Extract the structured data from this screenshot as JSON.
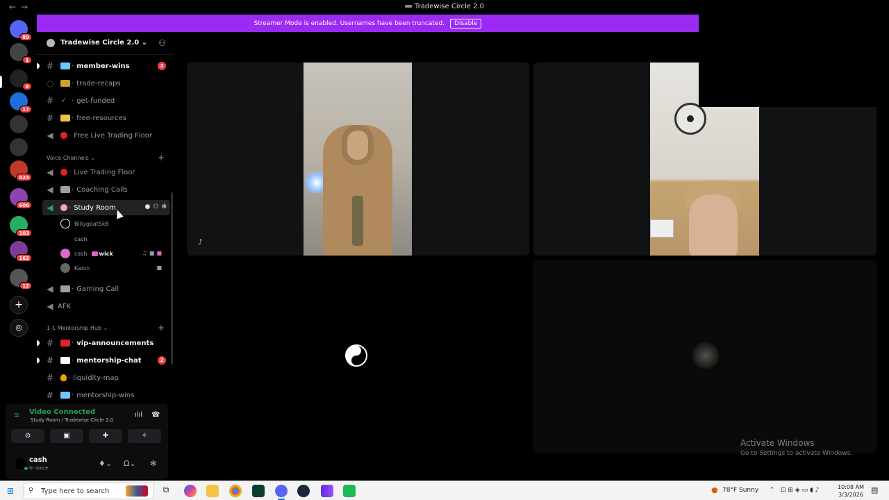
{
  "window": {
    "title": "Tradewise Circle 2.0",
    "back": "←",
    "forward": "→"
  },
  "banner": {
    "text": "Streamer Mode is enabled. Usernames have been truncated.",
    "button": "Disable"
  },
  "servers": [
    {
      "badge": "89",
      "color": "#5865f2"
    },
    {
      "badge": "1",
      "color": "#444"
    },
    {
      "badge": "8",
      "color": "#222"
    },
    {
      "badge": "17",
      "color": "#1e6fd9"
    },
    {
      "badge": "",
      "color": "#333"
    },
    {
      "badge": "",
      "color": "#333"
    },
    {
      "badge": "523",
      "color": "#c0392b"
    },
    {
      "badge": "606",
      "color": "#8e44ad"
    },
    {
      "badge": "103",
      "color": "#27ae60"
    },
    {
      "badge": "162",
      "color": "#7d3c98"
    },
    {
      "badge": "12",
      "color": "#555"
    }
  ],
  "guild": {
    "name": "Tradewise Circle 2.0 ⌄",
    "icon": "guild-gear-icon"
  },
  "channels": {
    "member_wins": {
      "label": "member-wins",
      "badge": "2"
    },
    "trade_recaps": {
      "label": "trade-recaps"
    },
    "get_funded": {
      "label": "get-funded"
    },
    "free_resources": {
      "label": "free-resources"
    },
    "free_live_trading_floor": {
      "label": "Free Live Trading Floor"
    }
  },
  "voice_category": {
    "label": "Voice Channels ⌄",
    "add": "+"
  },
  "voice": {
    "live_trading_floor": {
      "label": "Live Trading Floor"
    },
    "coaching_calls": {
      "label": "Coaching Calls"
    },
    "study_room": {
      "label": "Study Room"
    },
    "gaming_call": {
      "label": "Gaming Call"
    },
    "afk": {
      "label": "AFK"
    }
  },
  "participants": [
    {
      "name": "BillygoatSk8",
      "tag": ""
    },
    {
      "name": "cash",
      "tag": ""
    },
    {
      "name": "cash",
      "tag": "wick"
    },
    {
      "name": "Kalon",
      "tag": ""
    }
  ],
  "mentorship_category": {
    "label": "1-1 Mentorship Hub ⌄",
    "add": "+"
  },
  "mentorship": {
    "vip_announcements": {
      "label": "vip-announcements"
    },
    "mentorship_chat": {
      "label": "mentorship-chat",
      "badge": "2"
    },
    "liquidity_map": {
      "label": "liquidity-map"
    },
    "mentorship_wins": {
      "label": "mentorship-wins"
    }
  },
  "voice_panel": {
    "status": "Video Connected",
    "sub": "Study Room / Tradewise Circle 2.0"
  },
  "me": {
    "name": "cash",
    "status": "In voice"
  },
  "watermark": {
    "line1": "Activate Windows",
    "line2": "Go to Settings to activate Windows."
  },
  "taskbar": {
    "search_placeholder": "Type here to search",
    "weather": "78°F  Sunny",
    "time": "10:08 AM",
    "date": "3/3/2026"
  },
  "colors": {
    "accent": "#9b2bf2",
    "green": "#23a55a",
    "red": "#f23f43"
  }
}
